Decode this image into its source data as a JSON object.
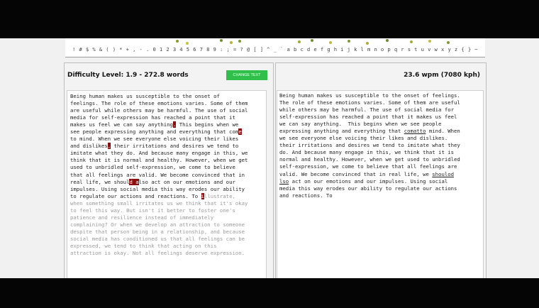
{
  "character_bar": "! # $ % & ( ) * + , - . 0 1 2 3 4 5 6 7 8 9 : ; = ? @ [ ] ^ _ ` a b c d e f g h i j k l m n o p q r s t u v w x y z { } ~",
  "left_panel": {
    "difficulty": "Difficulty Level: 1.9 - 272.8 words",
    "change_text_label": "CHANGE TEXT"
  },
  "right_panel": {
    "speed": "23.6 wpm (7080 kph)"
  },
  "typed_text": [
    "Being human makes us susceptible to the onset of feelings.",
    "The role of these emotions varies. Some of them are useful",
    "while others may be harmful. The use of social media for",
    "self-expression has reached a point that it makes us feel",
    "we can say anything.  This begins when we see people",
    "expressing anything and everything that ",
    "comatto",
    " mind. When",
    "we see everyone else voicing their likes and dislikes.",
    "their irritations and desires we tend to imitate what they",
    "do. And because many engage in this, we think that it is",
    "normal and healthy. However, when we get used to unbridled",
    "self-expression, we come to believe that all feelings are",
    "valid. We become convinced that in real life, we ",
    "shoulod",
    "lso",
    " act on our emotions and our impulses. Using social",
    "media this way erodes our ability to regulate our actions",
    "and reactions. To"
  ],
  "source_text": [
    "Being human makes us susceptible to the onset of",
    "feelings. The role of these emotions varies. Some of them",
    "are useful while others may be harmful. The use of social",
    "media for self-expression has reached a point that it",
    "makes us feel we can say anything",
    ".",
    " This begins when we",
    "see people expressing anything and everything that com",
    "e",
    "to mind. When we see everyone else voicing their likes",
    "and dislikes",
    ",",
    " their irritations and desires we tend to",
    "imitate what they do. And because many engage in this, we",
    "think that it is normal and healthy. However, when we get",
    "used to unbridled self-expression, we come to believe",
    "that all feelings are valid. We become convinced that in",
    "real life, we shoul",
    "d a",
    "lso act on our emotions and our",
    "impulses. Using social media this way erodes our ability",
    "to regulate our actions and reactions. To ",
    "i",
    "llustrate,",
    "when something small irritates us we think that it's okay",
    "to feel this way. But isn't it better to foster one's",
    "patience and resilience instead of immediately",
    "complaining? Or when we develop an attraction to someone",
    "despite that person being in a relationship, and because",
    "social media has conditioned us that all feelings can be",
    "expressed, we tend to think that acting on this",
    "attraction is okay. Not all feelings deserve expression."
  ]
}
